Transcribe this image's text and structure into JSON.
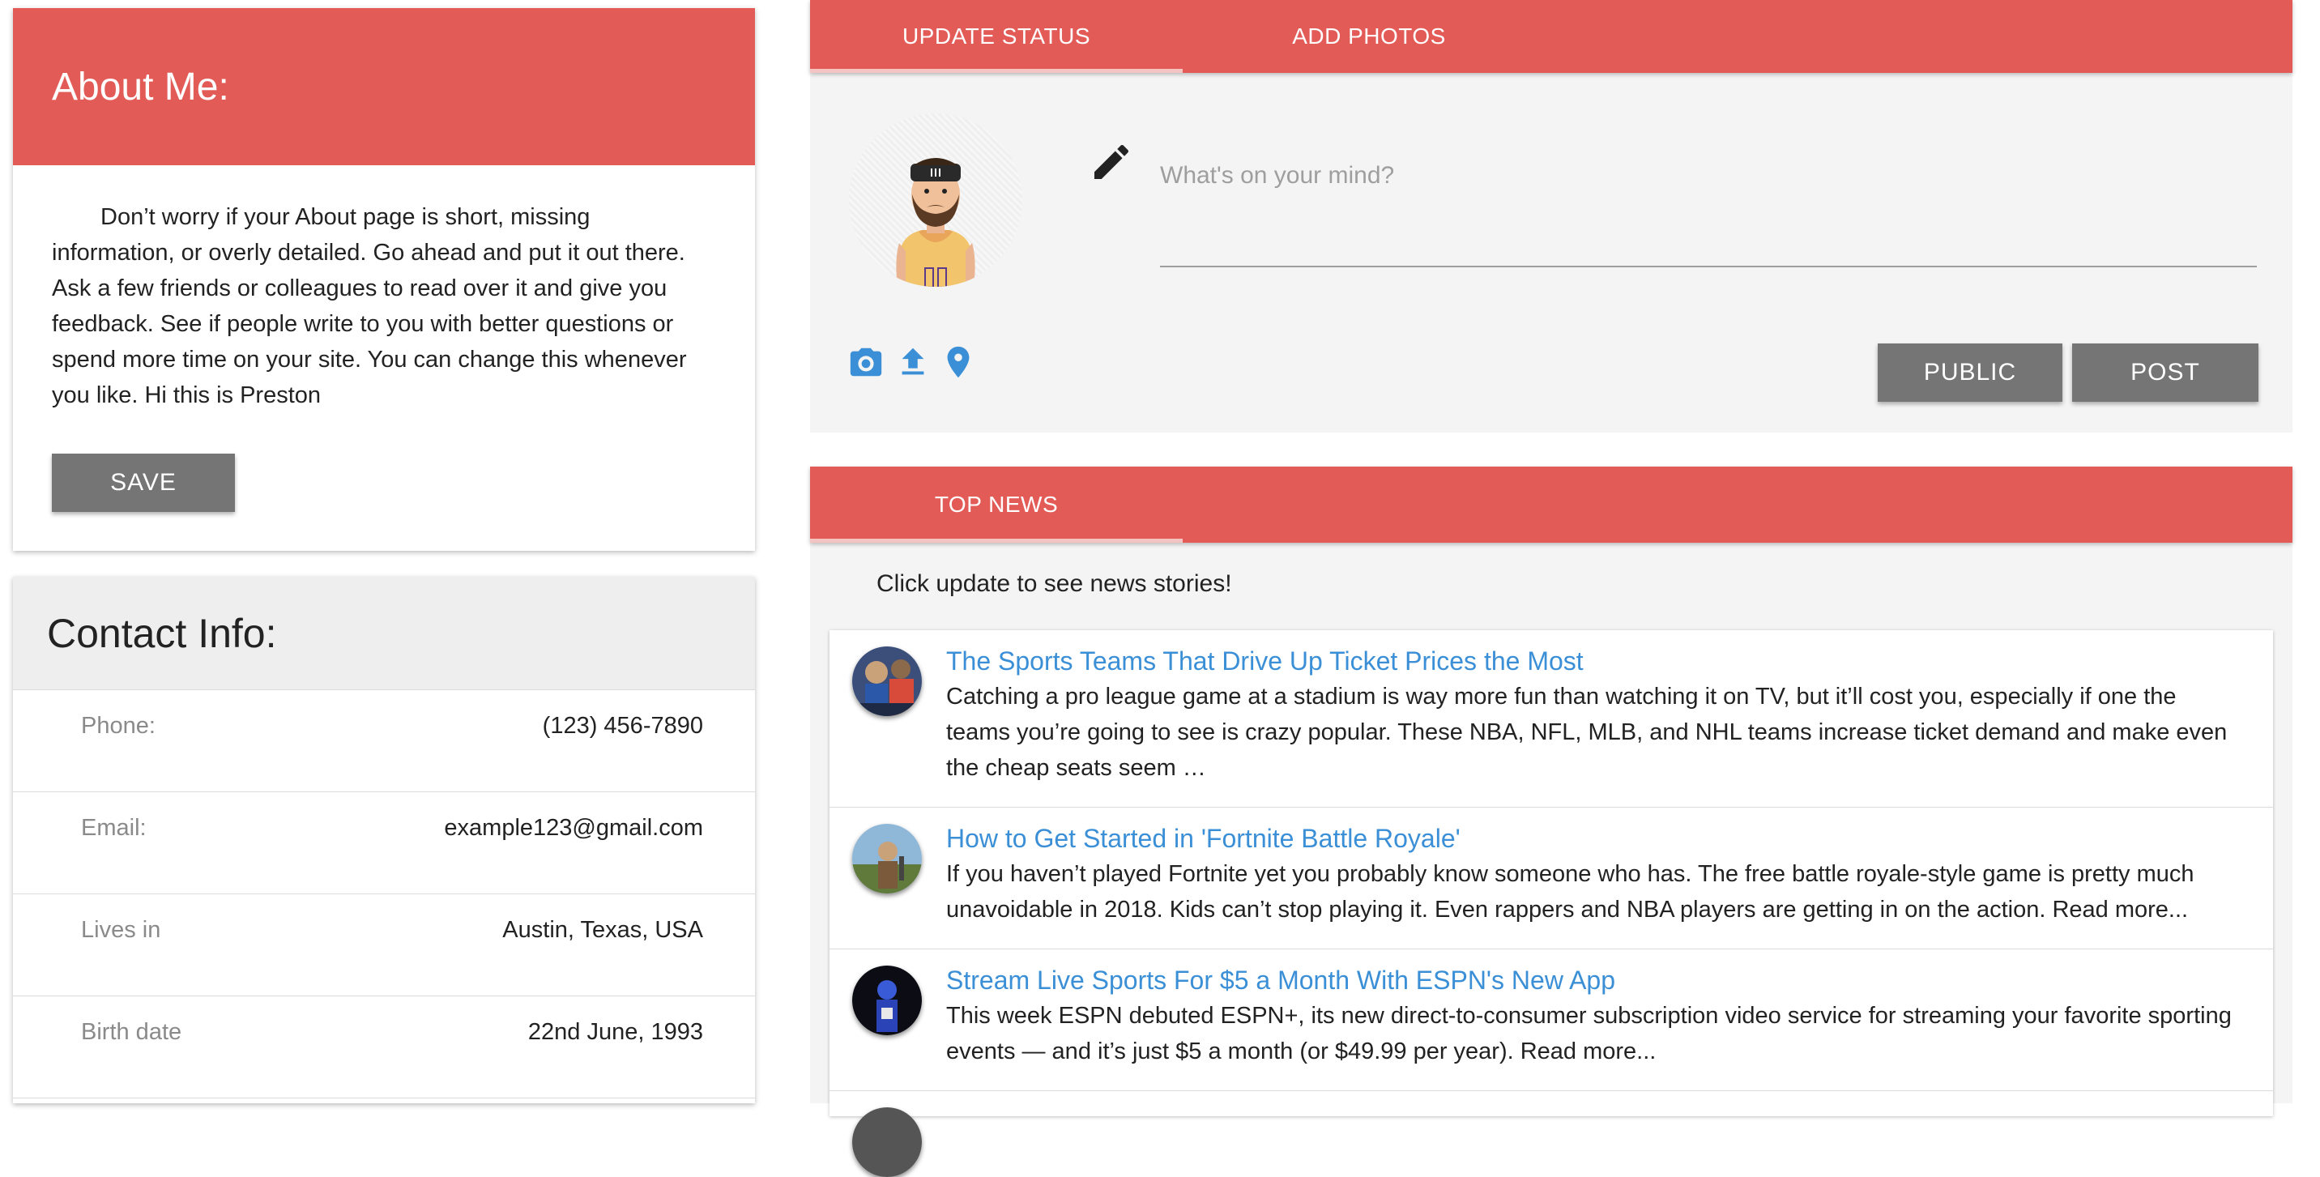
{
  "about": {
    "title": "About Me:",
    "body": "Don’t worry if your About page is short, missing information, or overly detailed. Go ahead and put it out there. Ask a few friends or colleagues to read over it and give you feedback. See if people write to you with better questions or spend more time on your site. You can change this whenever you like. Hi this is Preston",
    "save_label": "SAVE"
  },
  "contact": {
    "title": "Contact Info:",
    "rows": [
      {
        "label": "Phone:",
        "value": "(123) 456-7890"
      },
      {
        "label": "Email:",
        "value": "example123@gmail.com"
      },
      {
        "label": "Lives in",
        "value": "Austin, Texas, USA"
      },
      {
        "label": "Birth date",
        "value": "22nd June, 1993"
      }
    ]
  },
  "status": {
    "tabs": [
      {
        "label": "UPDATE STATUS",
        "active": true
      },
      {
        "label": "ADD PHOTOS",
        "active": false
      }
    ],
    "placeholder": "What's on your mind?",
    "public_label": "PUBLIC",
    "post_label": "POST",
    "icons": [
      "camera-icon",
      "upload-icon",
      "location-pin-icon"
    ]
  },
  "news": {
    "tab_label": "TOP NEWS",
    "hint": "Click update to see news stories!",
    "items": [
      {
        "title": "The Sports Teams That Drive Up Ticket Prices the Most",
        "desc": "Catching a pro league game at a stadium is way more fun than watching it on TV, but it’ll cost you, especially if one the teams you’re going to see is crazy popular. These NBA, NFL, MLB, and NHL teams increase ticket demand and make even the cheap seats seem …"
      },
      {
        "title": "How to Get Started in 'Fortnite Battle Royale'",
        "desc": "If you haven’t played Fortnite yet you probably know someone who has. The free battle royale-style game is pretty much unavoidable in 2018. Kids can’t stop playing it. Even rappers and NBA players are getting in on the action. Read more..."
      },
      {
        "title": "Stream Live Sports For $5 a Month With ESPN's New App",
        "desc": "This week ESPN debuted ESPN+, its new direct-to-consumer subscription video service for streaming your favorite sporting events — and it’s just $5 a month (or $49.99 per year). Read more..."
      }
    ]
  },
  "colors": {
    "accent": "#e35b57",
    "link": "#3a8fd6",
    "icon_blue": "#3a8fd6",
    "button_gray": "#757575"
  }
}
